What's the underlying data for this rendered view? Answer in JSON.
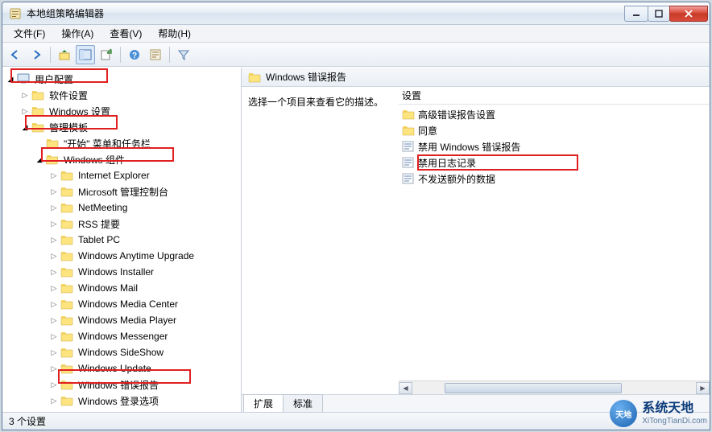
{
  "window": {
    "title": "本地组策略编辑器"
  },
  "menu": {
    "file": "文件(F)",
    "action": "操作(A)",
    "view": "查看(V)",
    "help": "帮助(H)"
  },
  "tree": {
    "root": "用户配置",
    "n_software": "软件设置",
    "n_winset": "Windows 设置",
    "n_admin": "管理模板",
    "n_startmenu": "\"开始\" 菜单和任务栏",
    "n_wincomp": "Windows 组件",
    "items": [
      "Internet Explorer",
      "Microsoft 管理控制台",
      "NetMeeting",
      "RSS 提要",
      "Tablet PC",
      "Windows Anytime Upgrade",
      "Windows Installer",
      "Windows Mail",
      "Windows Media Center",
      "Windows Media Player",
      "Windows Messenger",
      "Windows SideShow",
      "Windows Update",
      "Windows 错误报告",
      "Windows 登录选项"
    ]
  },
  "right": {
    "title": "Windows 错误报告",
    "prompt": "选择一个项目来查看它的描述。",
    "colSetting": "设置",
    "items": [
      {
        "kind": "folder",
        "label": "高级错误报告设置"
      },
      {
        "kind": "folder",
        "label": "同意"
      },
      {
        "kind": "setting",
        "label": "禁用 Windows 错误报告"
      },
      {
        "kind": "setting",
        "label": "禁用日志记录"
      },
      {
        "kind": "setting",
        "label": "不发送额外的数据"
      }
    ],
    "tabs": {
      "extended": "扩展",
      "standard": "标准"
    }
  },
  "status": "3 个设置",
  "watermark": {
    "name": "系统天地",
    "url": "XiTongTianDi.com"
  }
}
